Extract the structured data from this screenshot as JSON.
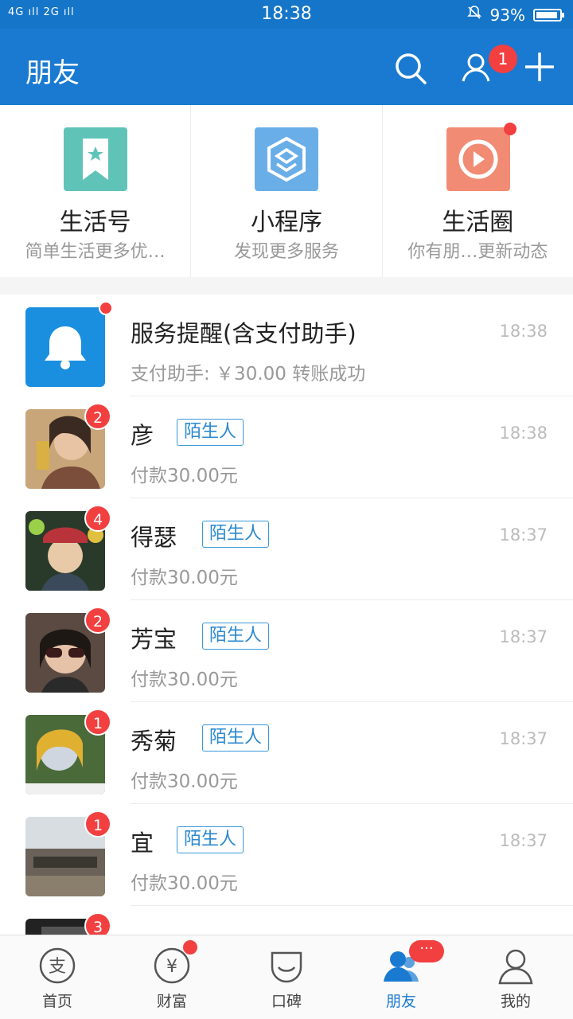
{
  "status_bar": {
    "signal": "4G ıll 2G ıll",
    "time": "18:38",
    "battery": "93%"
  },
  "header": {
    "title": "朋友",
    "friend_badge": "1"
  },
  "shortcuts": [
    {
      "label": "生活号",
      "sub": "简单生活更多优…",
      "icon": "bookmark-star-icon",
      "color": "#5fc3b8"
    },
    {
      "label": "小程序",
      "sub": "发现更多服务",
      "icon": "mini-program-icon",
      "color": "#6aaee8"
    },
    {
      "label": "生活圈",
      "sub": "你有朋…更新动态",
      "icon": "play-circle-icon",
      "color": "#f28b74"
    }
  ],
  "conversations": [
    {
      "name": "服务提醒(含支付助手)",
      "msg": "支付助手: ￥30.00 转账成功",
      "time": "18:38",
      "tag": "",
      "count": ""
    },
    {
      "name": "彦",
      "msg": "付款30.00元",
      "time": "18:38",
      "tag": "陌生人",
      "count": "2"
    },
    {
      "name": "得瑟",
      "msg": "付款30.00元",
      "time": "18:37",
      "tag": "陌生人",
      "count": "4"
    },
    {
      "name": "芳宝",
      "msg": "付款30.00元",
      "time": "18:37",
      "tag": "陌生人",
      "count": "2"
    },
    {
      "name": "秀菊",
      "msg": "付款30.00元",
      "time": "18:37",
      "tag": "陌生人",
      "count": "1"
    },
    {
      "name": "宜",
      "msg": "付款30.00元",
      "time": "18:37",
      "tag": "陌生人",
      "count": "1"
    },
    {
      "name": "",
      "msg": "",
      "time": "",
      "tag": "",
      "count": "3"
    }
  ],
  "tabs": [
    {
      "label": "首页",
      "icon": "alipay-icon"
    },
    {
      "label": "财富",
      "icon": "yen-icon"
    },
    {
      "label": "口碑",
      "icon": "koubei-icon"
    },
    {
      "label": "朋友",
      "icon": "friends-icon",
      "more": "···"
    },
    {
      "label": "我的",
      "icon": "person-icon"
    }
  ],
  "colors": {
    "brand": "#1a7ad1",
    "badge": "#f24040",
    "tag": "#2b89cf"
  }
}
